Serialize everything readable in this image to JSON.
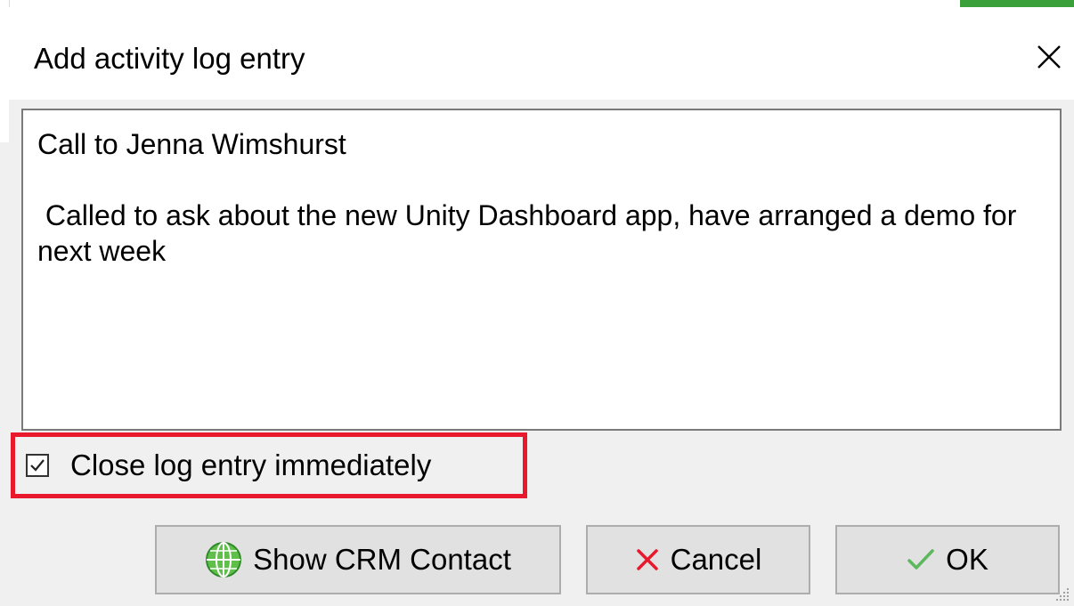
{
  "dialog": {
    "title": "Add activity log entry",
    "notes_text": "Call to Jenna Wimshurst\n\n Called to ask about the new Unity Dashboard app, have arranged a demo for next week",
    "checkbox": {
      "label": "Close log entry immediately",
      "checked": true,
      "highlight_color": "#e8192c"
    },
    "buttons": {
      "show_crm_label": "Show CRM Contact",
      "cancel_label": "Cancel",
      "ok_label": "OK"
    }
  },
  "icons": {
    "close": "close-icon",
    "crm": "globe-icon",
    "cancel": "x-icon",
    "ok": "checkmark-icon"
  },
  "colors": {
    "cancel_icon": "#e8192c",
    "ok_icon": "#5cb85c",
    "crm_icon": "#4caf50"
  }
}
